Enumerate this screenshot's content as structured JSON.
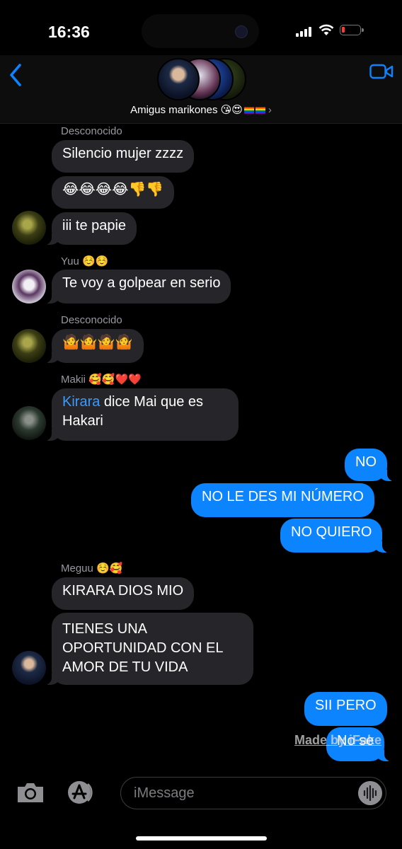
{
  "status": {
    "time": "16:36"
  },
  "header": {
    "group_name": "Amigus marikones",
    "group_emojis": "😘😍"
  },
  "messages": {
    "s1_sender": "Desconocido",
    "m1": "Silencio mujer zzzz",
    "m2": "😂😂😂😂👎👎",
    "m3": "iii te papie",
    "s2_sender": "Yuu ☺️☺️",
    "m4": "Te voy a golpear en serio",
    "s3_sender": "Desconocido",
    "m5": "🤷🤷🤷🤷",
    "s4_sender": "Makii 🥰🥰❤️❤️",
    "m6_mention": "Kirara",
    "m6_rest": " dice Mai que es",
    "m6_line2": "Hakari",
    "o1": "NO",
    "o2": "NO LE DES MI NÚMERO",
    "o3": "NO QUIERO",
    "s5_sender": "Meguu ☺️🥰",
    "m7": "KIRARA DIOS MIO",
    "m8_l1": "TIENES UNA",
    "m8_l2": "OPORTUNIDAD CON EL",
    "m8_l3": "AMOR DE TU VIDA",
    "o4": "SII PERO",
    "o5": "No se"
  },
  "watermark": "Made by iFake",
  "composer": {
    "placeholder": "iMessage"
  },
  "colors": {
    "outgoing": "#0b84fe",
    "incoming": "#26262a",
    "accent": "#0a84ff"
  },
  "icons": [
    "back-chevron-icon",
    "video-call-icon",
    "camera-icon",
    "app-store-icon",
    "audio-waveform-icon",
    "wifi-icon",
    "signal-icon",
    "battery-icon"
  ]
}
